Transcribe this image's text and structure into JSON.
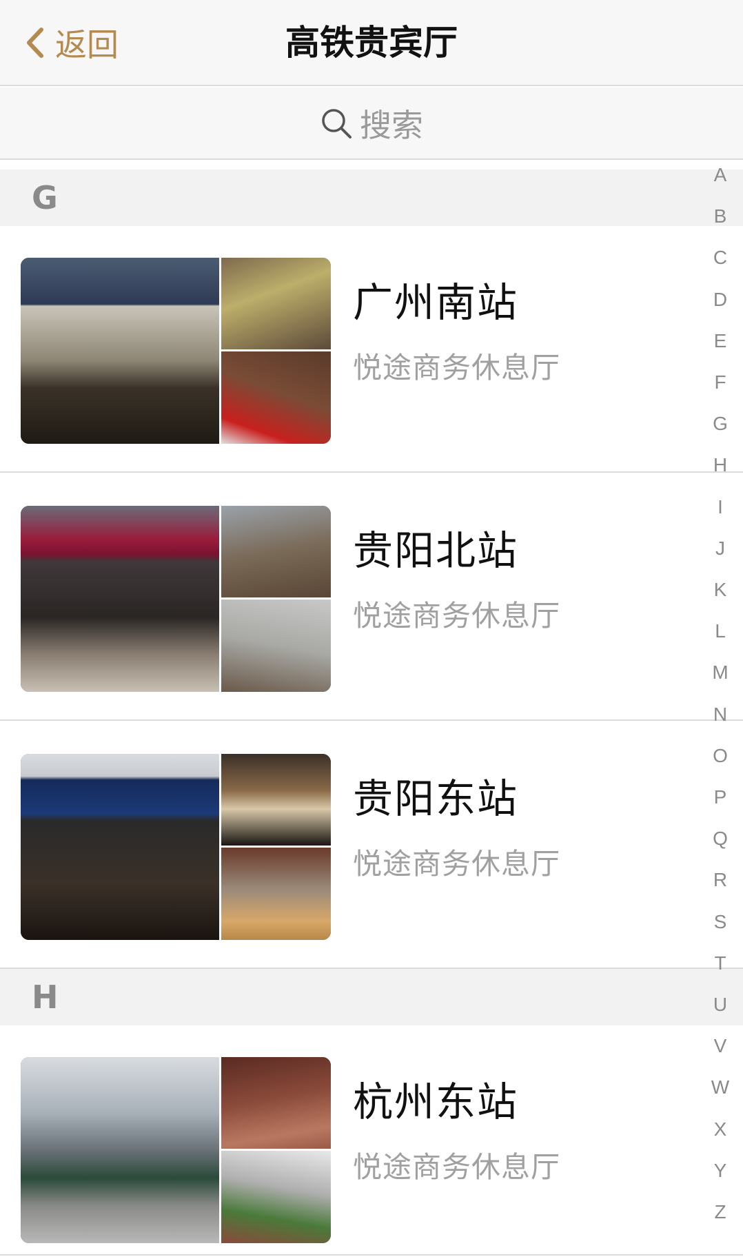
{
  "navbar": {
    "back_label": "返回",
    "title": "高铁贵宾厅"
  },
  "search": {
    "placeholder": "搜索"
  },
  "sections": [
    {
      "letter": "G",
      "items": [
        {
          "name": "广州南站",
          "subtitle": "悦途商务休息厅"
        },
        {
          "name": "贵阳北站",
          "subtitle": "悦途商务休息厅"
        },
        {
          "name": "贵阳东站",
          "subtitle": "悦途商务休息厅"
        }
      ]
    },
    {
      "letter": "H",
      "items": [
        {
          "name": "杭州东站",
          "subtitle": "悦途商务休息厅"
        }
      ]
    }
  ],
  "index_letters": [
    "A",
    "B",
    "C",
    "D",
    "E",
    "F",
    "G",
    "H",
    "I",
    "J",
    "K",
    "L",
    "M",
    "N",
    "O",
    "P",
    "Q",
    "R",
    "S",
    "T",
    "U",
    "V",
    "W",
    "X",
    "Y",
    "Z"
  ],
  "colors": {
    "accent": "#b48a50",
    "title": "#111111",
    "subtitle": "#a0a0a0",
    "section_bg": "#f2f2f2"
  }
}
